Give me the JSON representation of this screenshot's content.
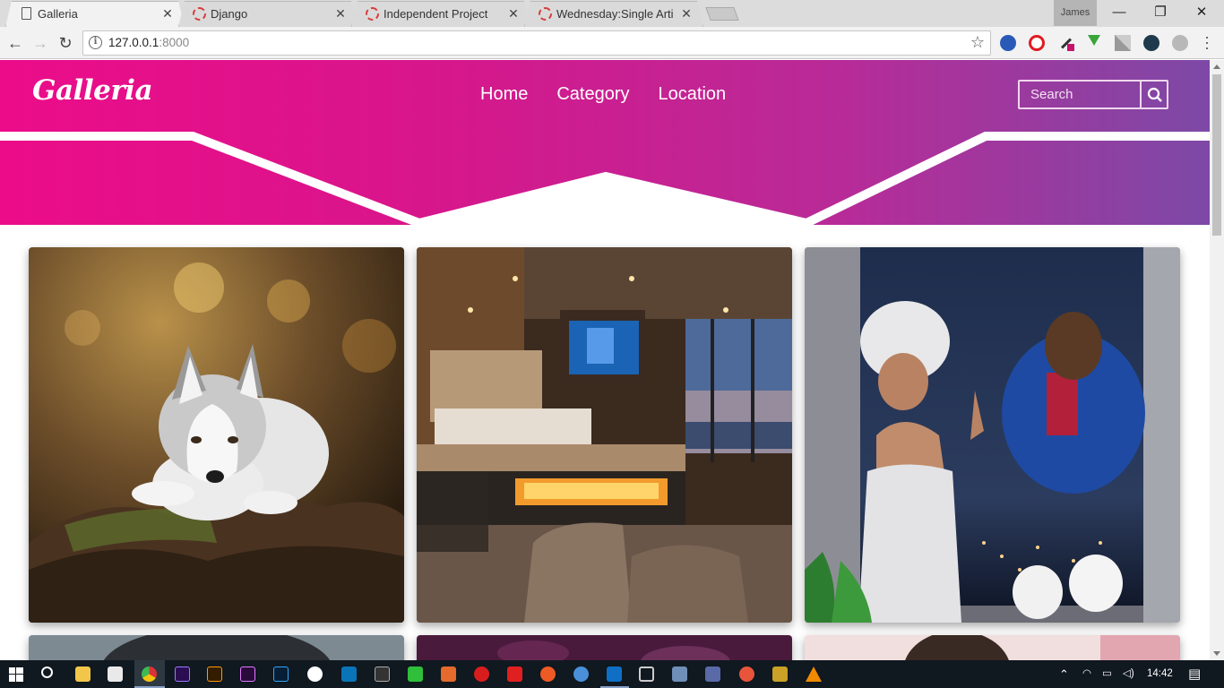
{
  "browser": {
    "tabs": [
      {
        "title": "Galleria",
        "icon": "document-icon",
        "active": true
      },
      {
        "title": "Django",
        "icon": "loading-icon",
        "active": false
      },
      {
        "title": "Independent Project",
        "icon": "loading-icon",
        "active": false
      },
      {
        "title": "Wednesday:Single Article",
        "icon": "loading-icon",
        "active": false
      }
    ],
    "profile_name": "James",
    "address": {
      "host": "127.0.0.1",
      "port": ":8000"
    }
  },
  "site": {
    "brand": "Galleria",
    "nav": [
      "Home",
      "Category",
      "Location"
    ],
    "search_placeholder": "Search",
    "header_gradient": [
      "#ec0c8a",
      "#7d49a6"
    ],
    "gallery": [
      {
        "subject": "husky dog resting on a mossy log"
      },
      {
        "subject": "modern bedroom with fireplace and city view"
      },
      {
        "subject": "illustration of a couple separated by a window"
      },
      {
        "subject": "portrait (partially visible)"
      },
      {
        "subject": "purple pattern (partially visible)"
      },
      {
        "subject": "portrait (partially visible)"
      }
    ]
  },
  "taskbar": {
    "time": "14:42"
  }
}
